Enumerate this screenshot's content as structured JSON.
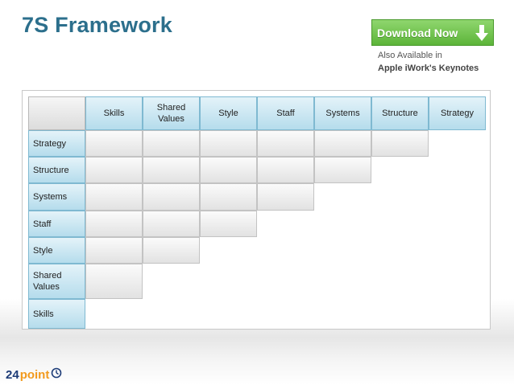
{
  "title": "7S Framework",
  "download": {
    "label": "Download Now",
    "icon": "download-arrow-icon",
    "color": "#6cc247"
  },
  "availability": {
    "line1": "Also Available in",
    "line2": "Apple iWork's Keynotes"
  },
  "matrix": {
    "columns": [
      "Skills",
      "Shared Values",
      "Style",
      "Staff",
      "Systems",
      "Structure",
      "Strategy"
    ],
    "rows": [
      "Strategy",
      "Structure",
      "Systems",
      "Staff",
      "Style",
      "Shared Values",
      "Skills"
    ],
    "filled_cells_per_row": [
      6,
      5,
      4,
      3,
      2,
      1,
      0
    ],
    "header_color": "#b5dcec",
    "cell_color": "#e2e2e2"
  },
  "logo": {
    "number": "24",
    "word": "point",
    "icon": "clock-icon"
  }
}
